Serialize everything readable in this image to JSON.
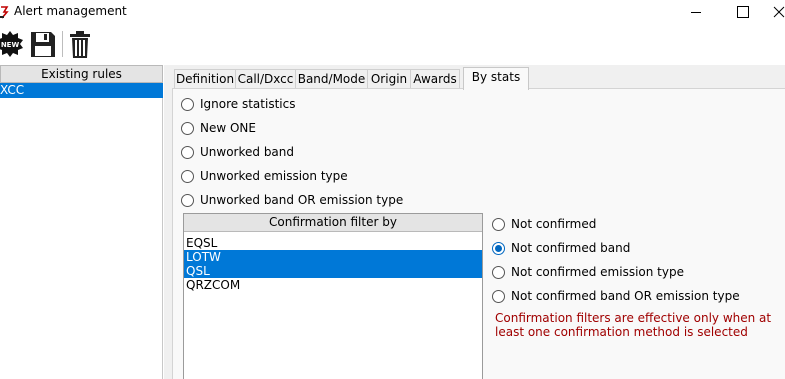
{
  "window": {
    "title": "Alert management"
  },
  "toolbar": {
    "new_icon_text": "NEW"
  },
  "left_panel": {
    "header": "Existing rules",
    "items": [
      "XCC"
    ]
  },
  "tabs": [
    "Definition",
    "Call/Dxcc",
    "Band/Mode",
    "Origin",
    "Awards",
    "By stats"
  ],
  "active_tab": "By stats",
  "stats_options": [
    {
      "label": "Ignore statistics",
      "checked": false
    },
    {
      "label": "New ONE",
      "checked": false
    },
    {
      "label": "Unworked band",
      "checked": false
    },
    {
      "label": "Unworked emission type",
      "checked": false
    },
    {
      "label": "Unworked band OR emission type",
      "checked": false
    }
  ],
  "confirmation": {
    "header": "Confirmation filter by",
    "items": [
      {
        "label": "EQSL",
        "selected": false
      },
      {
        "label": "LOTW",
        "selected": true
      },
      {
        "label": "QSL",
        "selected": true
      },
      {
        "label": "QRZCOM",
        "selected": false
      }
    ],
    "options": [
      {
        "label": "Not confirmed",
        "checked": false
      },
      {
        "label": "Not confirmed band",
        "checked": true
      },
      {
        "label": "Not confirmed emission type",
        "checked": false
      },
      {
        "label": "Not confirmed band OR emission type",
        "checked": false
      }
    ],
    "warning": "Confirmation filters are effective only when at least one confirmation method is selected"
  },
  "colors": {
    "selection": "#0078d7",
    "warning": "#a00000",
    "radio_checked": "#0067c0"
  }
}
